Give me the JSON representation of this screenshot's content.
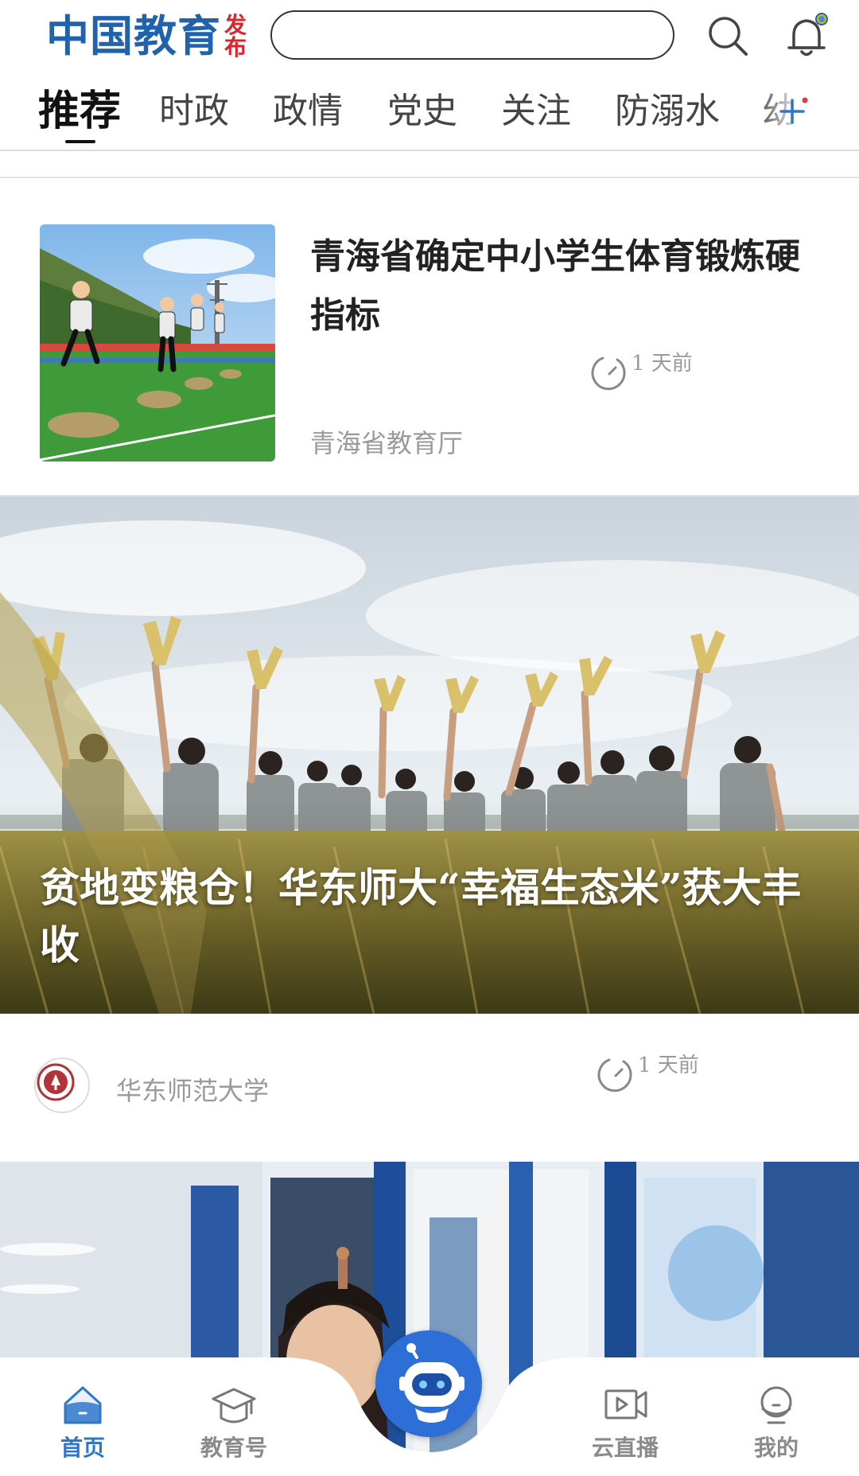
{
  "header": {
    "logo_main": "中国教育",
    "logo_sub_top": "发",
    "logo_sub_bottom": "布",
    "search_placeholder": "",
    "accent_color": "#1f63ad",
    "brand_red": "#d9252b"
  },
  "tabs": [
    {
      "label": "推荐",
      "active": true
    },
    {
      "label": "时政",
      "active": false
    },
    {
      "label": "政情",
      "active": false
    },
    {
      "label": "党史",
      "active": false
    },
    {
      "label": "关注",
      "active": false
    },
    {
      "label": "防溺水",
      "active": false
    },
    {
      "label": "幼",
      "active": false
    }
  ],
  "feed": [
    {
      "title": "青海省确定中小学生体育锻炼硬指标",
      "source": "青海省教育厅",
      "time": "1 天前",
      "image": "children-jumping-sandbags"
    },
    {
      "title": "贫地变粮仓！华东师大“幸福生态米”获大丰收",
      "source": "华东师范大学",
      "time": "1 天前",
      "image": "people-raising-rice-in-field"
    },
    {
      "title": "",
      "image": "woman-in-classroom"
    }
  ],
  "bottom_nav": [
    {
      "label": "首页",
      "icon": "home-icon",
      "active": true
    },
    {
      "label": "教育号",
      "icon": "graduation-cap-icon",
      "active": false
    },
    {
      "label": "",
      "icon": "robot-icon",
      "active": false
    },
    {
      "label": "云直播",
      "icon": "video-play-icon",
      "active": false
    },
    {
      "label": "我的",
      "icon": "user-icon",
      "active": false
    }
  ]
}
